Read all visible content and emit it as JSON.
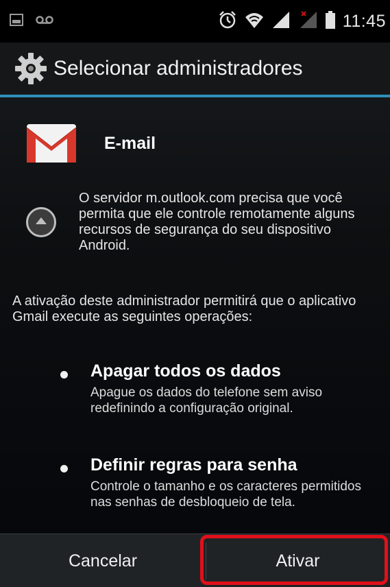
{
  "status_bar": {
    "time": "11:45",
    "icons": [
      "gallery-icon",
      "voicemail-icon",
      "alarm-icon",
      "wifi-icon",
      "signal-icon",
      "signal-no-service-icon",
      "battery-icon"
    ]
  },
  "action_bar": {
    "title": "Selecionar administradores",
    "icon": "gear-icon",
    "accent_color": "#2f8fb8"
  },
  "app": {
    "name": "E-mail",
    "icon": "gmail-icon"
  },
  "server_message": "O servidor m.outlook.com precisa que você permita que ele controle remotamente alguns recursos de segurança do seu dispositivo Android.",
  "activation_message": "A ativação deste administrador permitirá que o aplicativo Gmail execute as seguintes operações:",
  "policies": [
    {
      "title": "Apagar todos os dados",
      "description": "Apague os dados do telefone sem aviso redefinindo a configuração original."
    },
    {
      "title": "Definir regras para senha",
      "description": "Controle o tamanho e os caracteres permitidos nas senhas de desbloqueio de tela."
    }
  ],
  "buttons": {
    "cancel": "Cancelar",
    "activate": "Ativar"
  },
  "highlight_color": "#e0101a"
}
